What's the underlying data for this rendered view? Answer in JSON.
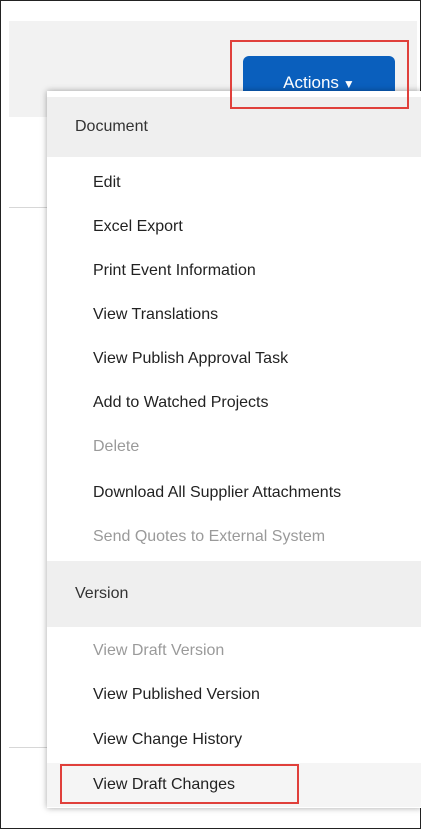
{
  "toolbar": {
    "actions_label": "Actions",
    "actions_caret": "▼"
  },
  "menu": {
    "sections": [
      {
        "header": "Document",
        "items": [
          {
            "label": "Edit",
            "enabled": true
          },
          {
            "label": "Excel Export",
            "enabled": true
          },
          {
            "label": "Print Event Information",
            "enabled": true
          },
          {
            "label": "View Translations",
            "enabled": true
          },
          {
            "label": "View Publish Approval Task",
            "enabled": true
          },
          {
            "label": "Add to Watched Projects",
            "enabled": true
          },
          {
            "label": "Delete",
            "enabled": false
          },
          {
            "label": "Download All Supplier Attachments",
            "enabled": true
          },
          {
            "label": "Send Quotes to External System",
            "enabled": false
          }
        ]
      },
      {
        "header": "Version",
        "items": [
          {
            "label": "View Draft Version",
            "enabled": false
          },
          {
            "label": "View Published Version",
            "enabled": true
          },
          {
            "label": "View Change History",
            "enabled": true
          },
          {
            "label": "View Draft Changes",
            "enabled": true
          }
        ]
      }
    ]
  },
  "colors": {
    "button_blue": "#0a5fbd",
    "highlight_red": "#e0403b",
    "disabled_text": "#9a9a9a",
    "header_bg": "#efefef"
  }
}
